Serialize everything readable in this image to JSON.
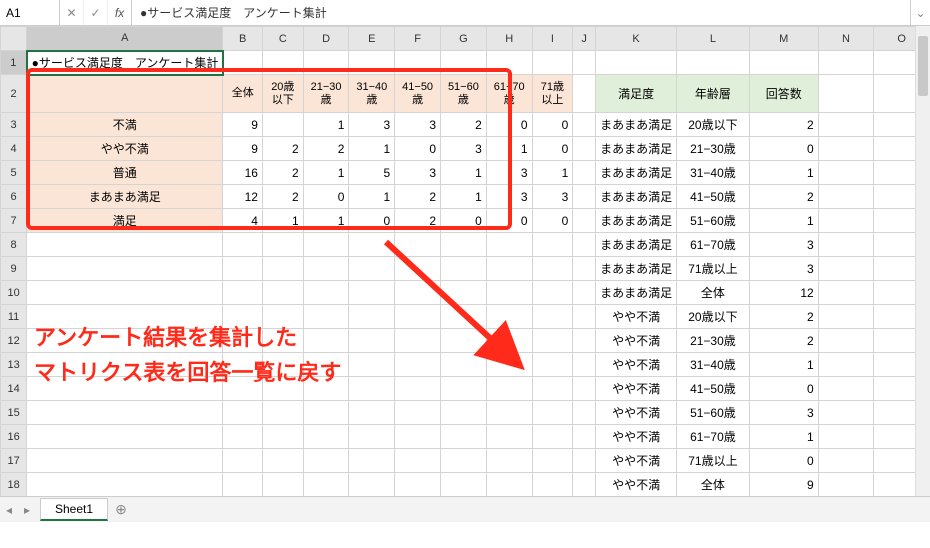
{
  "namebox": "A1",
  "formula": "●サービス満足度　アンケート集計",
  "fx_label": "fx",
  "cancel_glyph": "✕",
  "confirm_glyph": "✓",
  "expand_glyph": "⌄",
  "columns": [
    "A",
    "B",
    "C",
    "D",
    "E",
    "F",
    "G",
    "H",
    "I",
    "J",
    "K",
    "L",
    "M",
    "N",
    "O"
  ],
  "row_count": 18,
  "title": "●サービス満足度　アンケート集計",
  "matrix": {
    "col_headers": [
      "全体",
      "20歳以下",
      "21−30歳",
      "31−40歳",
      "41−50歳",
      "51−60歳",
      "61−70歳",
      "71歳以上"
    ],
    "rows": [
      {
        "label": "不満",
        "vals": [
          "9",
          "",
          "1",
          "3",
          "3",
          "2",
          "0",
          "0"
        ]
      },
      {
        "label": "やや不満",
        "vals": [
          "9",
          "2",
          "2",
          "1",
          "0",
          "3",
          "1",
          "0"
        ]
      },
      {
        "label": "普通",
        "vals": [
          "16",
          "2",
          "1",
          "5",
          "3",
          "1",
          "3",
          "1"
        ]
      },
      {
        "label": "まあまあ満足",
        "vals": [
          "12",
          "2",
          "0",
          "1",
          "2",
          "1",
          "3",
          "3"
        ]
      },
      {
        "label": "満足",
        "vals": [
          "4",
          "1",
          "1",
          "0",
          "2",
          "0",
          "0",
          "0"
        ]
      }
    ]
  },
  "annotation": {
    "line1": "アンケート結果を集計した",
    "line2": "マトリクス表を回答一覧に戻す"
  },
  "right_table": {
    "headers": [
      "満足度",
      "年齢層",
      "回答数"
    ],
    "rows": [
      [
        "まあまあ満足",
        "20歳以下",
        "2"
      ],
      [
        "まあまあ満足",
        "21−30歳",
        "0"
      ],
      [
        "まあまあ満足",
        "31−40歳",
        "1"
      ],
      [
        "まあまあ満足",
        "41−50歳",
        "2"
      ],
      [
        "まあまあ満足",
        "51−60歳",
        "1"
      ],
      [
        "まあまあ満足",
        "61−70歳",
        "3"
      ],
      [
        "まあまあ満足",
        "71歳以上",
        "3"
      ],
      [
        "まあまあ満足",
        "全体",
        "12"
      ],
      [
        "やや不満",
        "20歳以下",
        "2"
      ],
      [
        "やや不満",
        "21−30歳",
        "2"
      ],
      [
        "やや不満",
        "31−40歳",
        "1"
      ],
      [
        "やや不満",
        "41−50歳",
        "0"
      ],
      [
        "やや不満",
        "51−60歳",
        "3"
      ],
      [
        "やや不満",
        "61−70歳",
        "1"
      ],
      [
        "やや不満",
        "71歳以上",
        "0"
      ],
      [
        "やや不満",
        "全体",
        "9"
      ]
    ]
  },
  "sheet_tab": "Sheet1",
  "nav": {
    "first": "◂",
    "prev": "◂",
    "next": "▸",
    "last": "▸",
    "add": "⊕"
  }
}
